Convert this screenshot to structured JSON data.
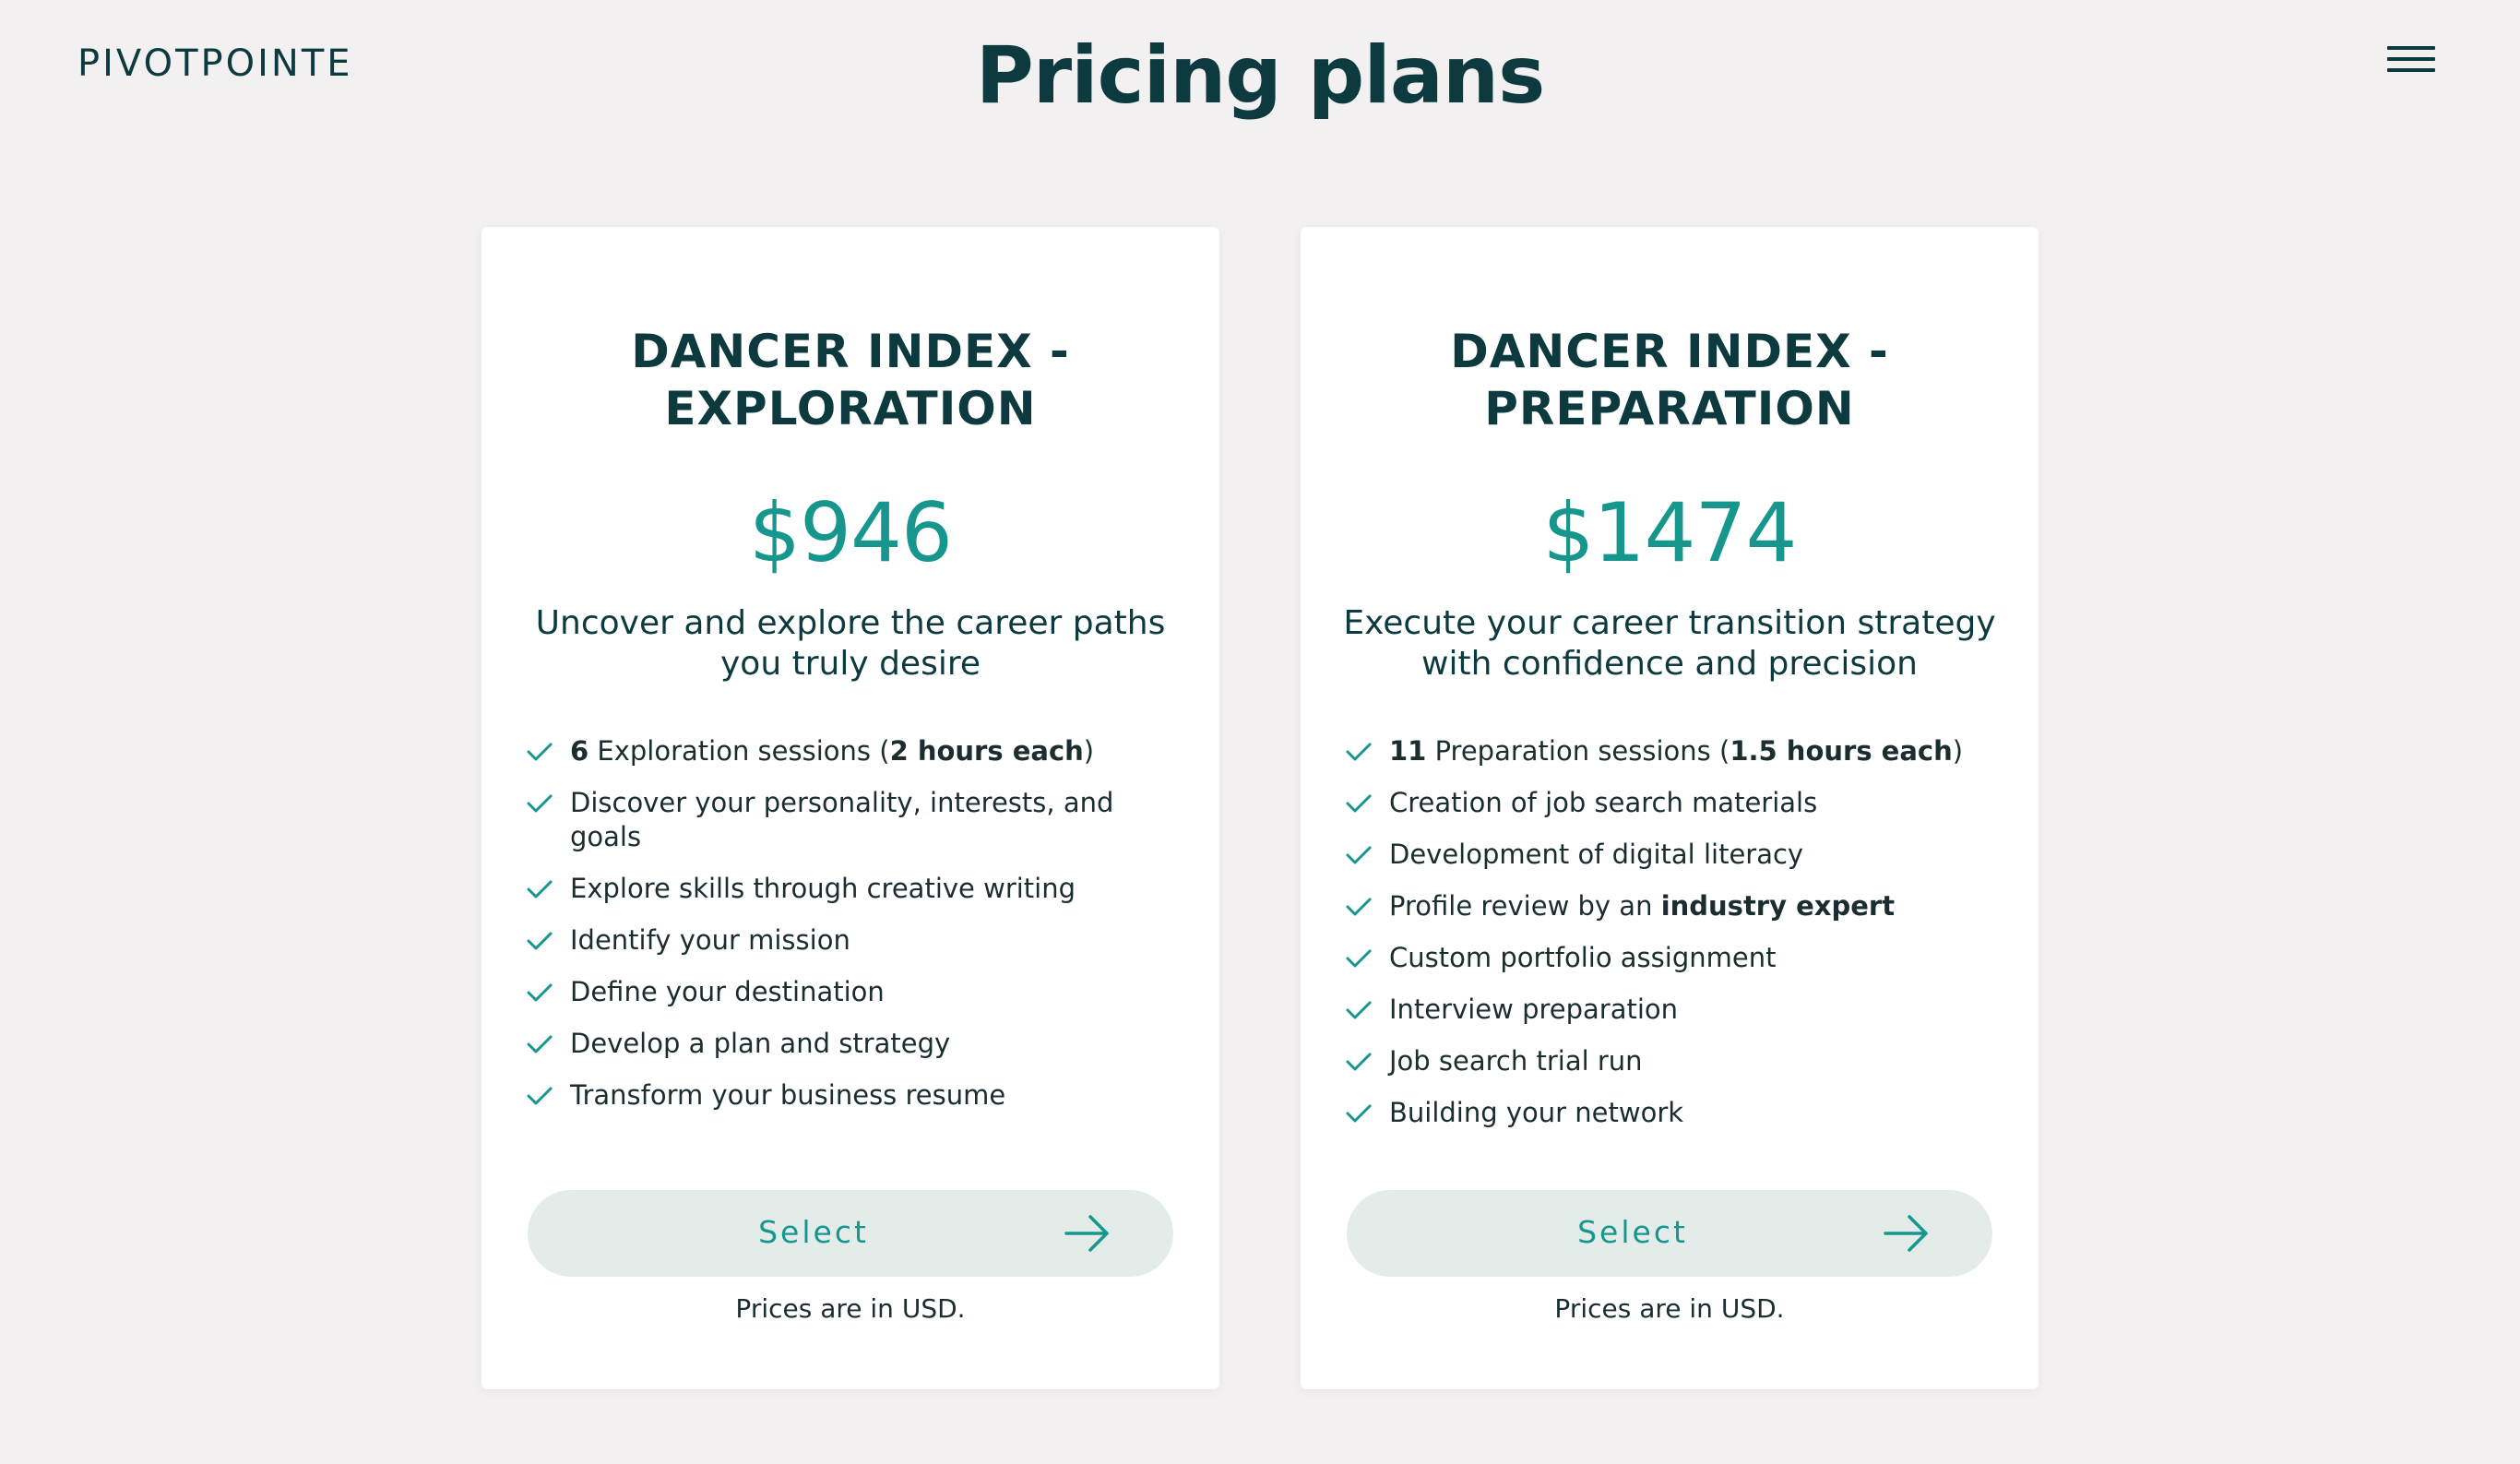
{
  "header": {
    "logo": "PIVOTPOINTE",
    "title": "Pricing plans",
    "menu_icon": "hamburger-menu-icon"
  },
  "colors": {
    "background": "#f2f0f0",
    "card": "#ffffff",
    "heading": "#0d3a3e",
    "accent": "#17968e",
    "button_bg": "#e4ecea"
  },
  "plans": [
    {
      "title_line1": "DANCER INDEX -",
      "title_line2": "EXPLORATION",
      "price": "$946",
      "desc_line1": "Uncover and explore the career paths",
      "desc_line2": "you truly desire",
      "features": [
        {
          "parts": [
            {
              "text": "6",
              "bold": true
            },
            {
              "text": " Exploration sessions ("
            },
            {
              "text": "2 hours each",
              "bold": true
            },
            {
              "text": ")"
            }
          ]
        },
        {
          "parts": [
            {
              "text": "Discover your personality, interests, and goals"
            }
          ]
        },
        {
          "parts": [
            {
              "text": "Explore skills through creative writing"
            }
          ]
        },
        {
          "parts": [
            {
              "text": "Identify your mission"
            }
          ]
        },
        {
          "parts": [
            {
              "text": "Define your destination"
            }
          ]
        },
        {
          "parts": [
            {
              "text": "Develop a plan and strategy"
            }
          ]
        },
        {
          "parts": [
            {
              "text": "Transform your business resume"
            }
          ]
        }
      ],
      "button_label": "Select",
      "note": "Prices are in USD."
    },
    {
      "title_line1": "DANCER INDEX -",
      "title_line2": "PREPARATION",
      "price": "$1474",
      "desc_line1": "Execute your career transition strategy",
      "desc_line2": "with confidence and precision",
      "features": [
        {
          "parts": [
            {
              "text": "11",
              "bold": true
            },
            {
              "text": " Preparation sessions ("
            },
            {
              "text": "1.5 hours each",
              "bold": true
            },
            {
              "text": ")"
            }
          ]
        },
        {
          "parts": [
            {
              "text": "Creation of job search materials"
            }
          ]
        },
        {
          "parts": [
            {
              "text": "Development of digital literacy"
            }
          ]
        },
        {
          "parts": [
            {
              "text": "Profile review by an "
            },
            {
              "text": "industry expert",
              "bold": true
            }
          ]
        },
        {
          "parts": [
            {
              "text": "Custom portfolio assignment"
            }
          ]
        },
        {
          "parts": [
            {
              "text": "Interview preparation"
            }
          ]
        },
        {
          "parts": [
            {
              "text": "Job search trial run"
            }
          ]
        },
        {
          "parts": [
            {
              "text": "Building your network"
            }
          ]
        }
      ],
      "button_label": "Select",
      "note": "Prices are in USD."
    }
  ]
}
